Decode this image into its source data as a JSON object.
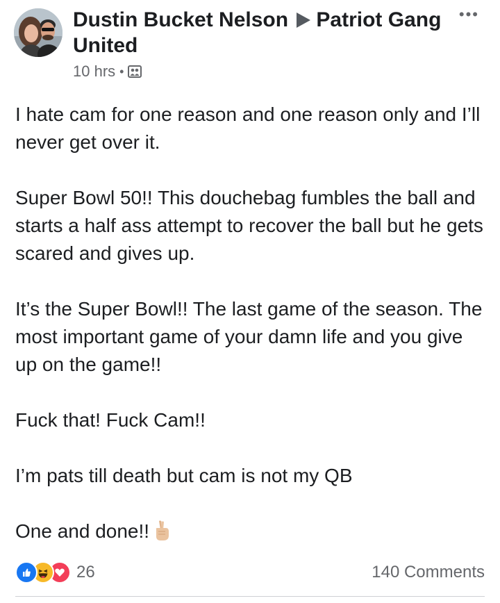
{
  "post": {
    "author": "Dustin Bucket Nelson",
    "group": "Patriot Gang United",
    "timestamp": "10 hrs",
    "separator": "•",
    "audience_icon": "group-audience-icon",
    "more_icon": "•••",
    "body": {
      "paragraphs": [
        "I hate cam for one reason and one reason only and I’ll never get over it.",
        "Super Bowl 50!! This douchebag fumbles the ball and starts a half ass attempt to recover the ball but he gets scared and gives up.",
        "It’s the Super Bowl!! The last game of the season. The most important game of your damn life and you give up on the game!!",
        "Fuck that! Fuck Cam!!",
        "I’m pats till death but cam is not my QB",
        "One and done!!"
      ],
      "trailing_emoji": "crossed-fingers-emoji"
    },
    "reactions": {
      "icons": [
        "like-icon",
        "haha-icon",
        "love-icon"
      ],
      "count": "26"
    },
    "comments": "140 Comments"
  },
  "colors": {
    "text": "#1c1e21",
    "muted": "#65676b",
    "like": "#1877f2",
    "haha": "#f7b928",
    "love": "#f33e58"
  }
}
